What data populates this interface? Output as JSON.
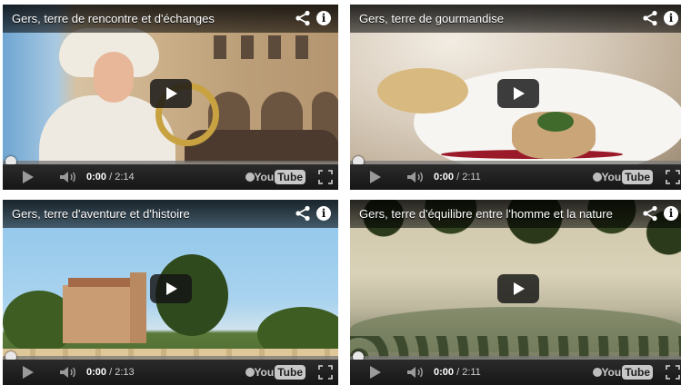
{
  "videos": [
    {
      "title": "Gers, terre de rencontre et d'échanges",
      "current_time": "0:00",
      "duration": "/ 2:14"
    },
    {
      "title": "Gers, terre de gourmandise",
      "current_time": "0:00",
      "duration": "/ 2:11"
    },
    {
      "title": "Gers, terre d'aventure et d'histoire",
      "current_time": "0:00",
      "duration": "/ 2:13"
    },
    {
      "title": "Gers, terre d'équilibre entre l'homme et la nature",
      "current_time": "0:00",
      "duration": "/ 2:11"
    }
  ],
  "logo": {
    "you": "You",
    "tube": "Tube"
  },
  "icons": {
    "share": "share-icon",
    "info": "info-icon",
    "play": "play-icon",
    "volume": "volume-icon",
    "watch_later": "clock-icon",
    "fullscreen": "fullscreen-icon"
  },
  "info_glyph": "i",
  "colors": {
    "titlebar": "#000000",
    "controls": "#1b1b1b",
    "text": "#ffffff"
  }
}
